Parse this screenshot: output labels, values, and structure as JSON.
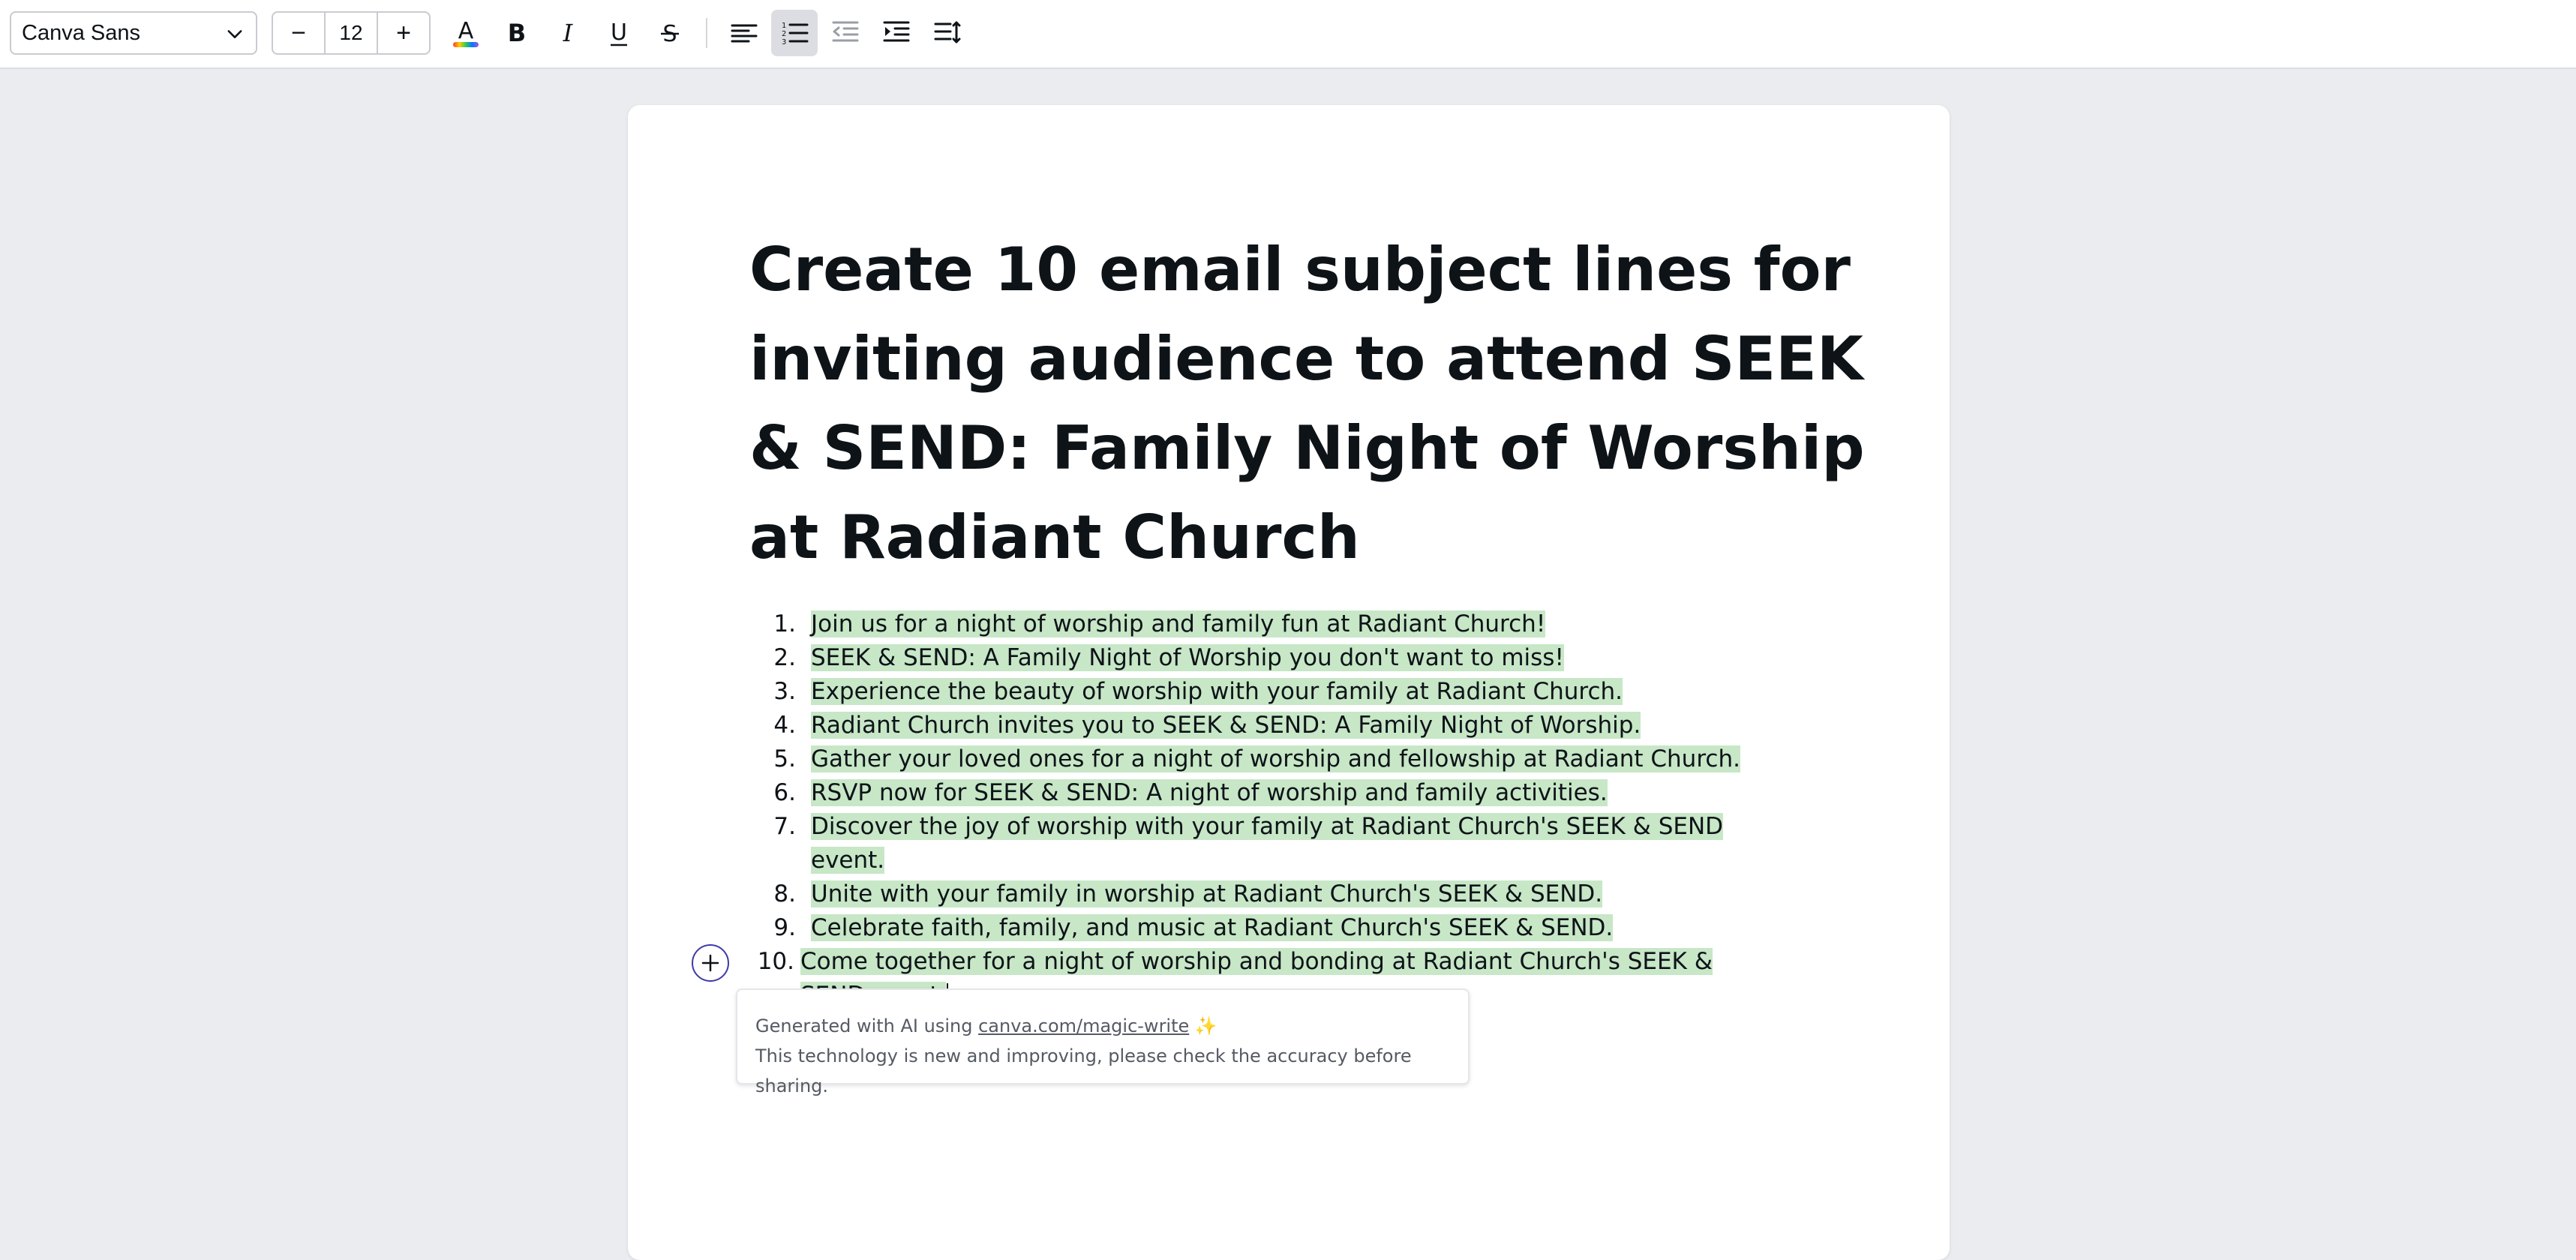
{
  "toolbar": {
    "font_name": "Canva Sans",
    "font_size": "12",
    "decrease_label": "−",
    "increase_label": "+",
    "text_color_glyph": "A",
    "bold_glyph": "B",
    "italic_glyph": "I",
    "underline_glyph": "U",
    "strike_glyph": "S",
    "active_tool": "numbered-list"
  },
  "document": {
    "title": "Create 10 email subject lines for inviting audience to attend SEEK & SEND: Family Night of Worship at Radiant Church",
    "list": [
      {
        "num": "1.",
        "text": "Join us for a night of worship and family fun at Radiant Church!"
      },
      {
        "num": "2.",
        "text": "SEEK & SEND: A Family Night of Worship you don't want to miss!"
      },
      {
        "num": "3.",
        "text": "Experience the beauty of worship with your family at Radiant Church."
      },
      {
        "num": "4.",
        "text": "Radiant Church invites you to SEEK & SEND: A Family Night of Worship."
      },
      {
        "num": "5.",
        "text": "Gather your loved ones for a night of worship and fellowship at Radiant Church."
      },
      {
        "num": "6.",
        "text": "RSVP now for SEEK & SEND: A night of worship and family activities."
      },
      {
        "num": "7.",
        "text": "Discover the joy of worship with your family at Radiant Church's SEEK & SEND event."
      },
      {
        "num": "8.",
        "text": "Unite with your family in worship at Radiant Church's SEEK & SEND."
      },
      {
        "num": "9.",
        "text": "Celebrate faith, family, and music at Radiant Church's SEEK & SEND."
      },
      {
        "num": "10.",
        "text": "Come together for a night of worship and bonding at Radiant Church's SEEK & SEND event."
      }
    ],
    "highlight_color": "#c7e7c7"
  },
  "ai_note": {
    "line1_prefix": "Generated with AI using ",
    "link": "canva.com/magic-write",
    "sparkle": "✨",
    "line2": "This technology is new and improving, please check the accuracy before sharing."
  },
  "colors": {
    "canvas_bg": "#ebecf0",
    "accent": "#3d3ba7",
    "text": "#0e1318"
  }
}
